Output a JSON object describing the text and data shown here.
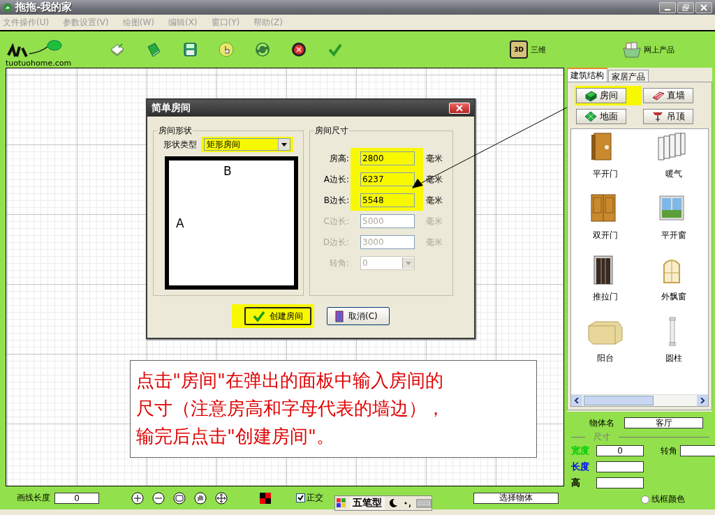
{
  "window": {
    "title": "拖拖-我的家"
  },
  "menu": [
    {
      "label": "文件操作(U)"
    },
    {
      "label": "参数设置(V)"
    },
    {
      "label": "绘图(W)"
    },
    {
      "label": "编辑(X)"
    },
    {
      "label": "窗口(Y)"
    },
    {
      "label": "帮助(Z)"
    }
  ],
  "toolbar": {
    "logo_text": "tuotuohome.com",
    "view_3d": {
      "badge": "3D",
      "label": "三维"
    },
    "online": {
      "label": "网上产品"
    }
  },
  "dialog": {
    "title": "简单房间",
    "shape_group": {
      "legend": "房间形状",
      "type_label": "形状类型",
      "type_value": "矩形房间",
      "highlighted": true,
      "top_label": "B",
      "left_label": "A"
    },
    "size_group": {
      "legend": "房间尺寸",
      "fields": [
        {
          "label": "房高:",
          "value": "2800",
          "unit": "毫米",
          "disabled": false,
          "highlighted": true
        },
        {
          "label": "A边长:",
          "value": "6237",
          "unit": "毫米",
          "disabled": false,
          "highlighted": true
        },
        {
          "label": "B边长:",
          "value": "5548",
          "unit": "毫米",
          "disabled": false,
          "highlighted": true
        },
        {
          "label": "C边长:",
          "value": "5000",
          "unit": "毫米",
          "disabled": true,
          "highlighted": false
        },
        {
          "label": "D边长:",
          "value": "3000",
          "unit": "毫米",
          "disabled": true,
          "highlighted": false
        }
      ],
      "angle": {
        "label": "转角:",
        "value": "0",
        "disabled": true
      }
    },
    "buttons": [
      {
        "label": "创建房间",
        "kind": "ok",
        "highlighted": true
      },
      {
        "label": "取消(C)",
        "kind": "cancel",
        "highlighted": false
      }
    ]
  },
  "annotation": {
    "lines": [
      "点击\"房间\"在弹出的面板中输入房间的",
      "尺寸（注意房高和字母代表的墙边），",
      "输完后点击\"创建房间\"。"
    ]
  },
  "side_panel": {
    "tabs": [
      {
        "label": "建筑结构",
        "selected": true
      },
      {
        "label": "家居产品",
        "selected": false
      }
    ],
    "buttons": [
      {
        "label": "房间",
        "kind": "room",
        "highlighted": true
      },
      {
        "label": "直墙",
        "kind": "wall",
        "highlighted": false
      },
      {
        "label": "地面",
        "kind": "floor",
        "highlighted": false
      },
      {
        "label": "吊顶",
        "kind": "ceiling",
        "highlighted": false
      }
    ],
    "items": [
      {
        "label": "平开门",
        "kind": "door"
      },
      {
        "label": "暖气",
        "kind": "radiator"
      },
      {
        "label": "双开门",
        "kind": "double-door"
      },
      {
        "label": "平开窗",
        "kind": "window"
      },
      {
        "label": "推拉门",
        "kind": "sliding-door"
      },
      {
        "label": "外飘窗",
        "kind": "bay-window"
      },
      {
        "label": "阳台",
        "kind": "balcony"
      },
      {
        "label": "圆柱",
        "kind": "column"
      }
    ]
  },
  "properties": {
    "name_label": "物体名",
    "name_value": "客厅",
    "section": "尺寸",
    "fields": [
      {
        "label": "宽度",
        "value": "0",
        "color": "#00cc00"
      },
      {
        "label": "长度",
        "color": "#0000ff"
      },
      {
        "label": "高",
        "color": "#000000"
      }
    ],
    "angle_label": "转角",
    "wireframe": {
      "label": "线框颜色",
      "selected": false
    }
  },
  "status_bar": {
    "length_label": "画线长度",
    "length_value": "0",
    "ortho": {
      "label": "正交",
      "checked": true
    },
    "ime": {
      "label": "五笔型"
    },
    "mode_value": "选择物体"
  }
}
